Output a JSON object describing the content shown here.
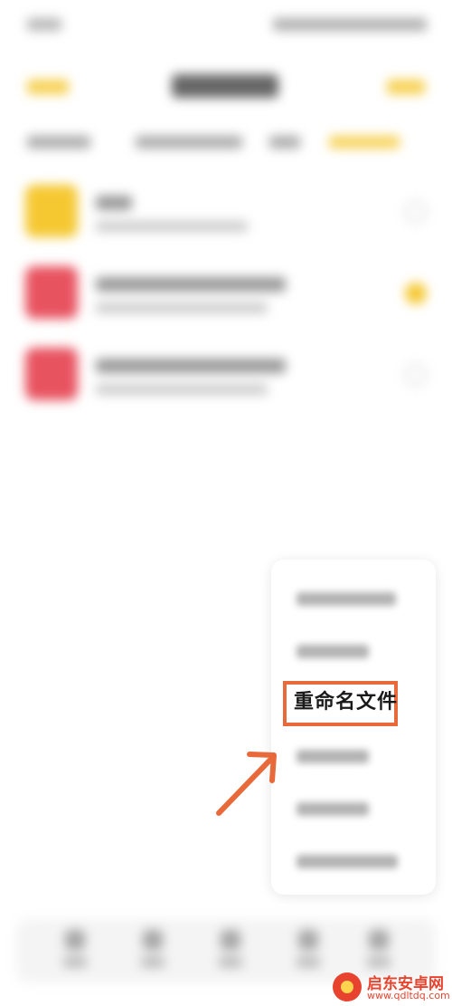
{
  "menu": {
    "highlighted_item": "重命名文件"
  },
  "colors": {
    "accent_yellow": "#f5c832",
    "file_red": "#e85360",
    "highlight": "#e86a3a",
    "watermark": "#e8432e"
  },
  "watermark": {
    "title": "启东安卓网",
    "url": "www.qdltdq.com"
  },
  "icons": [
    "folder-icon",
    "document-icon",
    "checkbox-icon",
    "arrow-pointer-icon",
    "watermark-logo-icon"
  ]
}
